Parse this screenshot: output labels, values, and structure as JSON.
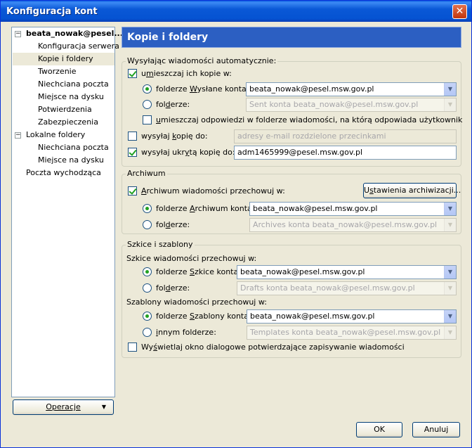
{
  "window": {
    "title": "Konfiguracja kont",
    "close_glyph": "✕"
  },
  "tree": {
    "account": "beata_nowak@pesel...",
    "account_expander": "−",
    "items": [
      "Konfiguracja serwera",
      "Kopie i foldery",
      "Tworzenie",
      "Niechciana poczta",
      "Miejsce na dysku",
      "Potwierdzenia",
      "Zabezpieczenia"
    ],
    "local": "Lokalne foldery",
    "local_expander": "−",
    "local_items": [
      "Niechciana poczta",
      "Miejsce na dysku"
    ],
    "outgoing": "Poczta wychodząca",
    "selected": "Kopie i foldery"
  },
  "operations_button": {
    "label": "Operacje",
    "arrow": "▼"
  },
  "header": {
    "title": "Kopie i foldery"
  },
  "sending": {
    "legend": "Wysyłając wiadomości automatycznie:",
    "save_copies": {
      "pre": "u",
      "key": "m",
      "post": "ieszczaj ich kopie w:",
      "checked": true
    },
    "sent_account": {
      "pre": "folderze ",
      "key": "W",
      "post": "ysłane konta:",
      "value": "beata_nowak@pesel.msw.gov.pl",
      "selected": true
    },
    "sent_folder": {
      "pre": "fol",
      "key": "d",
      "post": "erze:",
      "value": "Sent konta beata_nowak@pesel.msw.gov.pl",
      "selected": false
    },
    "reply_in_folder": {
      "pre": "",
      "key": "u",
      "post": "mieszczaj odpowiedzi w folderze wiadomości, na którą odpowiada użytkownik",
      "checked": false
    },
    "send_copy": {
      "pre": "wysyłaj ",
      "key": "k",
      "post": "opię do:",
      "checked": false,
      "placeholder": "adresy e-mail rozdzielone przecinkami"
    },
    "send_bcc": {
      "pre": "wysyłaj ukr",
      "key": "y",
      "post": "tą kopię do:",
      "checked": true,
      "value": "adm1465999@pesel.msw.gov.pl"
    }
  },
  "archive": {
    "legend": "Archiwum",
    "keep": {
      "pre": "",
      "key": "A",
      "post": "rchiwum wiadomości przechowuj w:",
      "checked": true
    },
    "settings_button": {
      "pre": "U",
      "key": "s",
      "post": "tawienia archiwizacji..."
    },
    "account": {
      "pre": "folderze ",
      "key": "A",
      "post": "rchiwum konta:",
      "value": "beata_nowak@pesel.msw.gov.pl",
      "selected": true
    },
    "folder": {
      "pre": "fol",
      "key": "d",
      "post": "erze:",
      "value": "Archives konta beata_nowak@pesel.msw.gov.pl",
      "selected": false
    }
  },
  "drafts": {
    "legend": "Szkice i szablony",
    "drafts_label": "Szkice wiadomości przechowuj w:",
    "drafts_account": {
      "pre": "folderze ",
      "key": "S",
      "post": "zkice konta:",
      "value": "beata_nowak@pesel.msw.gov.pl",
      "selected": true
    },
    "drafts_folder": {
      "pre": "fol",
      "key": "d",
      "post": "erze:",
      "value": "Drafts konta beata_nowak@pesel.msw.gov.pl",
      "selected": false
    },
    "templates_label": "Szablony wiadomości przechowuj w:",
    "templates_account": {
      "pre": "folderze ",
      "key": "S",
      "post": "zablony konta:",
      "value": "beata_nowak@pesel.msw.gov.pl",
      "selected": true
    },
    "templates_folder": {
      "pre": "",
      "key": "i",
      "post": "nnym folderze:",
      "value": "Templates konta beata_nowak@pesel.msw.gov.pl",
      "selected": false
    },
    "confirm": {
      "pre": "Wy",
      "key": "ś",
      "post": "wietlaj okno dialogowe potwierdzające zapisywanie wiadomości",
      "checked": false
    }
  },
  "footer": {
    "ok": "OK",
    "cancel": "Anuluj"
  },
  "dropdown_glyph": "▼"
}
